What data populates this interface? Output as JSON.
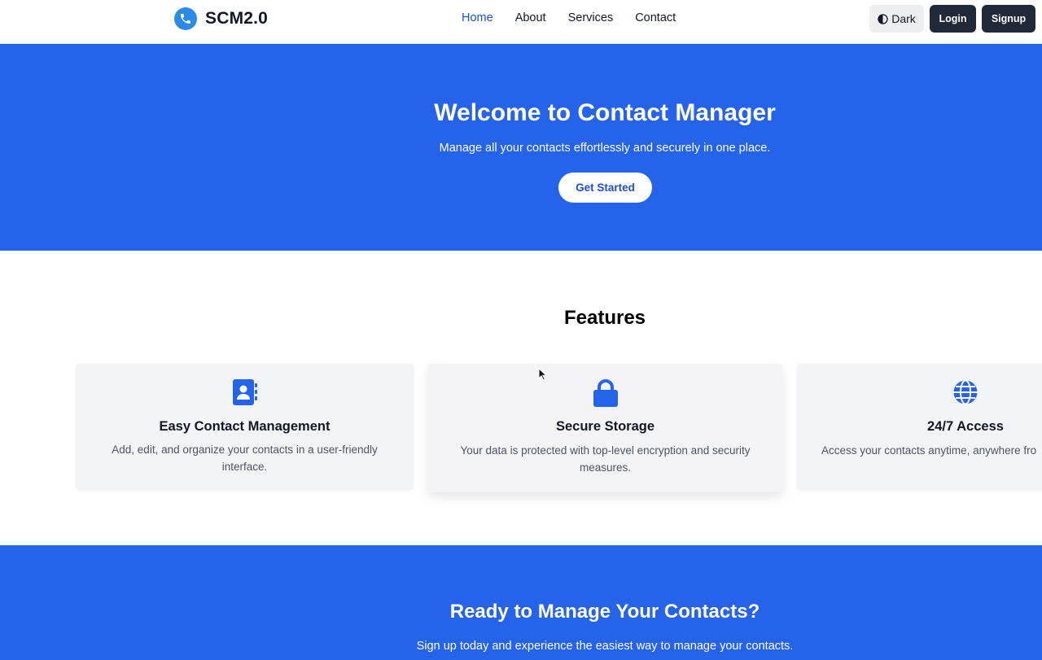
{
  "brand": {
    "name": "SCM2.0",
    "logo_icon": "phone-icon",
    "logo_color": "#2b8be6"
  },
  "nav": {
    "links": [
      {
        "label": "Home",
        "active": true
      },
      {
        "label": "About",
        "active": false
      },
      {
        "label": "Services",
        "active": false
      },
      {
        "label": "Contact",
        "active": false
      }
    ],
    "theme_toggle_label": "Dark",
    "login_label": "Login",
    "signup_label": "Signup"
  },
  "hero": {
    "title": "Welcome to Contact Manager",
    "subtitle": "Manage all your contacts effortlessly and securely in one place.",
    "cta_label": "Get Started"
  },
  "features": {
    "title": "Features",
    "items": [
      {
        "icon": "address-book-icon",
        "title": "Easy Contact Management",
        "text": "Add, edit, and organize your contacts in a user-friendly interface."
      },
      {
        "icon": "lock-icon",
        "title": "Secure Storage",
        "text": "Your data is protected with top-level encryption and security measures."
      },
      {
        "icon": "globe-icon",
        "title": "24/7 Access",
        "text": "Access your contacts anytime, anywhere fro"
      }
    ]
  },
  "cta": {
    "title": "Ready to Manage Your Contacts?",
    "subtitle": "Sign up today and experience the easiest way to manage your contacts."
  },
  "colors": {
    "primary": "#2563eb",
    "accent_text": "#1d4ed8",
    "dark_button": "#1f2937",
    "card_bg": "#f3f4f6"
  }
}
